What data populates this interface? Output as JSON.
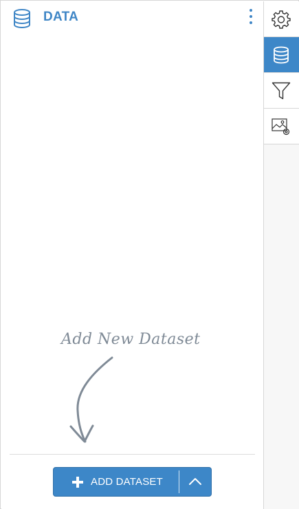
{
  "panel": {
    "title": "DATA",
    "hint": "Add New Dataset",
    "add_button_label": "ADD DATASET"
  },
  "icons": {
    "header": "database-icon",
    "menu": "more-vertical-icon",
    "add": "plus-icon",
    "expand": "chevron-up-icon"
  },
  "toolbar": [
    {
      "name": "settings",
      "icon": "gear-icon",
      "active": false
    },
    {
      "name": "data",
      "icon": "database-icon",
      "active": true
    },
    {
      "name": "filter",
      "icon": "filter-icon",
      "active": false
    },
    {
      "name": "image-settings",
      "icon": "image-settings-icon",
      "active": false
    }
  ],
  "colors": {
    "accent": "#3d87c8",
    "title": "#3f86c6",
    "hint": "#7f8a96",
    "border": "#d6d6d6"
  }
}
